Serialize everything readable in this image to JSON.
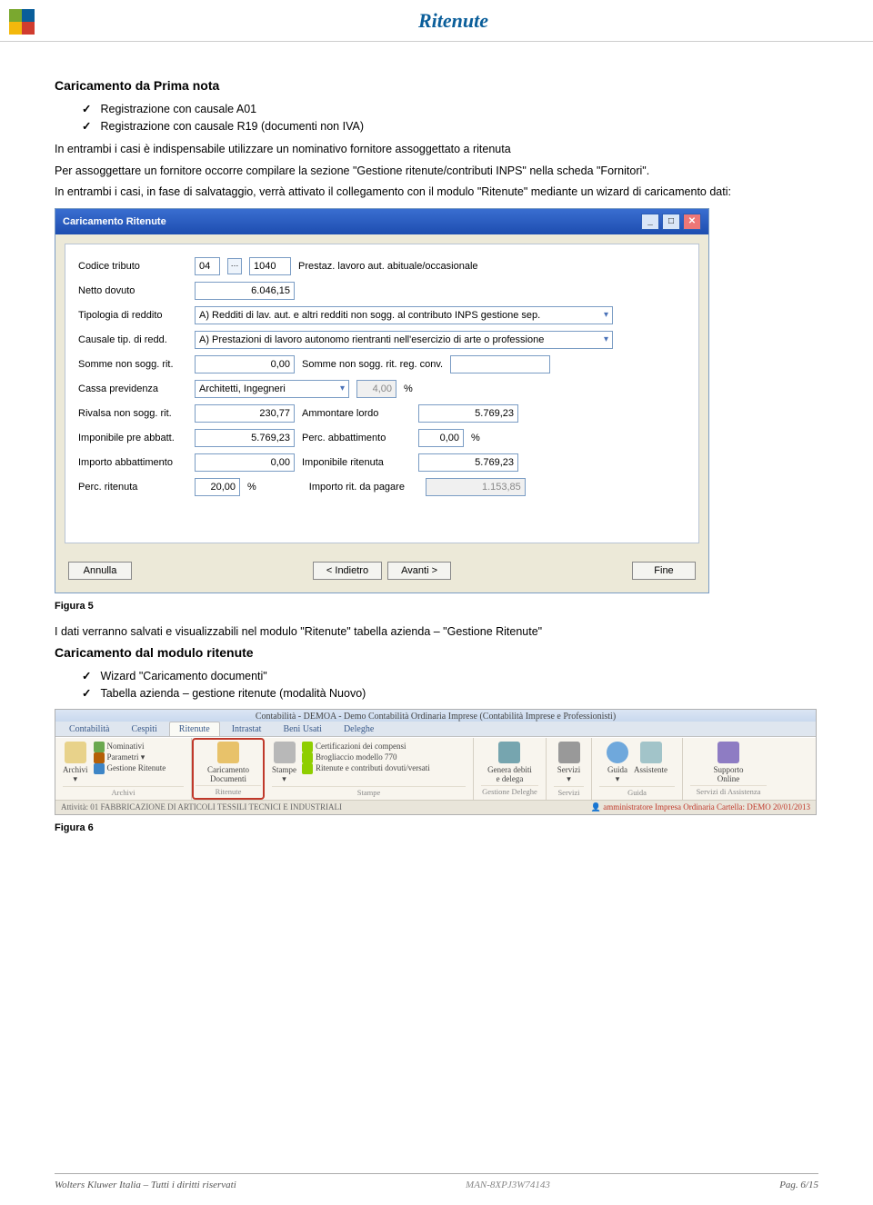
{
  "header": {
    "title": "Ritenute"
  },
  "section1": {
    "heading": "Caricamento da Prima nota",
    "bullets": [
      "Registrazione con causale A01",
      "Registrazione con causale R19 (documenti non IVA)"
    ],
    "p1": "In entrambi i casi è indispensabile utilizzare un nominativo fornitore assoggettato a ritenuta",
    "p2": "Per assoggettare un fornitore  occorre compilare la sezione \"Gestione ritenute/contributi INPS\" nella scheda \"Fornitori\".",
    "p3": "In entrambi i casi, in fase di salvataggio, verrà attivato il collegamento con il modulo \"Ritenute\" mediante un wizard di caricamento dati:"
  },
  "dialog": {
    "title": "Caricamento Ritenute",
    "fields": {
      "codice_tributo": {
        "label": "Codice tributo",
        "code": "04",
        "lookup": "1040",
        "desc": "Prestaz. lavoro aut. abituale/occasionale"
      },
      "netto_dovuto": {
        "label": "Netto dovuto",
        "value": "6.046,15"
      },
      "tipologia": {
        "label": "Tipologia di reddito",
        "value": "A) Redditi di lav. aut. e altri redditi non sogg. al contributo INPS gestione sep."
      },
      "causale": {
        "label": "Causale tip. di redd.",
        "value": "A) Prestazioni di lavoro autonomo rientranti nell'esercizio di arte o professione"
      },
      "somme_non": {
        "label": "Somme non sogg. rit.",
        "value": "0,00",
        "label2": "Somme non sogg. rit. reg. conv.",
        "value2": ""
      },
      "cassa": {
        "label": "Cassa previdenza",
        "value": "Architetti, Ingegneri",
        "perc": "4,00",
        "perc_sym": "%"
      },
      "rivalsa": {
        "label": "Rivalsa non sogg. rit.",
        "value": "230,77",
        "label2": "Ammontare lordo",
        "value2": "5.769,23"
      },
      "imponibile_pre": {
        "label": "Imponibile pre abbatt.",
        "value": "5.769,23",
        "label2": "Perc. abbattimento",
        "value2": "0,00",
        "sym": "%"
      },
      "importo_abb": {
        "label": "Importo abbattimento",
        "value": "0,00",
        "label2": "Imponibile ritenuta",
        "value2": "5.769,23"
      },
      "perc_rit": {
        "label": "Perc. ritenuta",
        "value": "20,00",
        "sym": "%",
        "label2": "Importo rit. da pagare",
        "value2": "1.153,85"
      }
    },
    "buttons": {
      "annulla": "Annulla",
      "indietro": "< Indietro",
      "avanti": "Avanti >",
      "fine": "Fine"
    }
  },
  "fig5": "Figura 5",
  "section2": {
    "p1": "I dati verranno salvati e visualizzabili nel modulo \"Ritenute\" tabella azienda – \"Gestione Ritenute\"",
    "heading": "Caricamento dal modulo ritenute",
    "bullets": [
      "Wizard \"Caricamento documenti\"",
      "Tabella azienda – gestione ritenute (modalità Nuovo)"
    ]
  },
  "ribbon": {
    "app_title": "Contabilità - DEMOA - Demo Contabilità Ordinaria Imprese (Contabilità Imprese e Professionisti)",
    "tabs": [
      "Contabilità",
      "Cespiti",
      "Ritenute",
      "Intrastat",
      "Beni Usati",
      "Deleghe"
    ],
    "active_tab": 2,
    "archivi": {
      "label": "Archivi",
      "items": [
        "Nominativi",
        "Parametri ▾",
        "Gestione Ritenute"
      ],
      "vbtn": "Archivi\n▾"
    },
    "ritenute": {
      "label": "Ritenute",
      "big": "Caricamento\nDocumenti",
      "stampe": "Stampe\n▾",
      "items": [
        "Certificazioni dei compensi",
        "Brogliaccio modello 770",
        "Ritenute e contributi dovuti/versati"
      ]
    },
    "deleghe": {
      "label": "Gestione Deleghe",
      "btn": "Genera debiti\ne delega"
    },
    "servizi": {
      "label": "Servizi",
      "btn": "Servizi\n▾"
    },
    "guida": {
      "label": "Guida",
      "btn1": "Guida\n▾",
      "btn2": "Assistente"
    },
    "assist": {
      "label": "Servizi di Assistenza",
      "btn": "Supporto\nOnline"
    },
    "status_l": "Attività: 01 FABBRICAZIONE DI ARTICOLI TESSILI TECNICI E INDUSTRIALI",
    "status_r": "amministratore  Impresa  Ordinaria  Cartella: DEMO  20/01/2013"
  },
  "fig6": "Figura 6",
  "footer": {
    "left": "Wolters Kluwer Italia – Tutti i diritti riservati",
    "doc": "MAN-8XPJ3W74143",
    "right": "Pag.  6/15"
  }
}
